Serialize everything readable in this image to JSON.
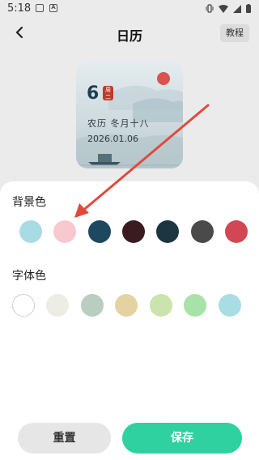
{
  "status": {
    "time": "5:18"
  },
  "nav": {
    "title": "日历",
    "tutorial_label": "教程"
  },
  "preview": {
    "day": "6",
    "seal_text": "周二",
    "lunar": "农历 冬月十八",
    "date": "2026.01.06"
  },
  "background_color": {
    "title": "背景色",
    "swatches": [
      "#a8dbe3",
      "#f7c9cf",
      "#1e4860",
      "#3a1c20",
      "#1d3540",
      "#4a4a4a",
      "#d14854"
    ]
  },
  "font_color": {
    "title": "字体色",
    "swatches": [
      "#ffffff",
      "#ededE6",
      "#b9cdc0",
      "#e3d3a2",
      "#cbe3ad",
      "#a7e2a8",
      "#a8dde3"
    ]
  },
  "actions": {
    "reset_label": "重置",
    "save_label": "保存"
  },
  "colors": {
    "accent": "#2fd1a1",
    "annotation_arrow": "#e04a3c"
  }
}
